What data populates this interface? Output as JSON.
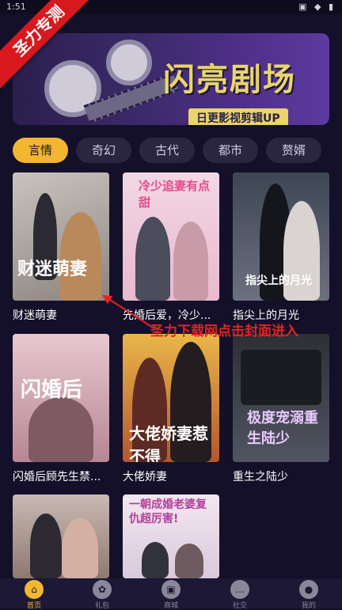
{
  "status": {
    "time": "1:51",
    "icons": "▣ ◆ ▮"
  },
  "ribbon": "圣力专测",
  "banner": {
    "title": "闪亮剧场",
    "subtitle": "日更影视剪辑UP"
  },
  "tabs": [
    "言情",
    "奇幻",
    "古代",
    "都市",
    "赘婿"
  ],
  "active_tab": 0,
  "dramas": [
    {
      "title": "财迷萌妻",
      "cover_text": "财迷萌妻"
    },
    {
      "title": "先婚后爱，冷少...",
      "cover_text": "冷少追妻有点甜"
    },
    {
      "title": "指尖上的月光",
      "cover_text": "指尖上的月光"
    },
    {
      "title": "闪婚后顾先生禁...",
      "cover_text": "闪婚后"
    },
    {
      "title": "大佬娇妻",
      "cover_text": "大佬娇妻惹不得"
    },
    {
      "title": "重生之陆少",
      "cover_text": "极度宠溺重生陆少"
    },
    {
      "title": "",
      "cover_text": ""
    },
    {
      "title": "",
      "cover_text": "一朝成婚老婆复仇超厉害!"
    }
  ],
  "annotation": "圣力下载网点击封面进入",
  "nav": [
    {
      "label": "首页",
      "icon": "home-icon",
      "glyph": "⌂"
    },
    {
      "label": "礼包",
      "icon": "gift-icon",
      "glyph": "✿"
    },
    {
      "label": "商城",
      "icon": "shop-icon",
      "glyph": "▣"
    },
    {
      "label": "社交",
      "icon": "chat-icon",
      "glyph": "…"
    },
    {
      "label": "我的",
      "icon": "user-icon",
      "glyph": "●"
    }
  ],
  "active_nav": 0,
  "colors": {
    "accent": "#f2b630",
    "bg": "#141029",
    "annotation": "#e52222"
  }
}
